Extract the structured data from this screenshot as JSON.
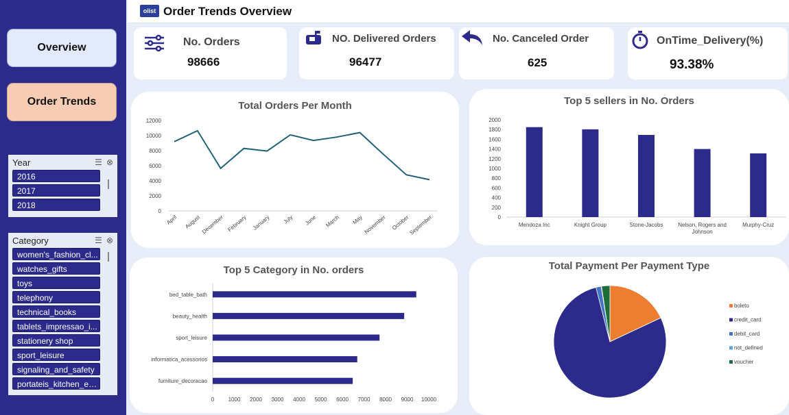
{
  "nav": {
    "overview_label": "Overview",
    "order_trends_label": "Order Trends"
  },
  "header": {
    "logo_text": "olist",
    "title": "Order Trends Overview"
  },
  "slicers": {
    "year": {
      "title": "Year",
      "items": [
        "2016",
        "2017",
        "2018"
      ]
    },
    "category": {
      "title": "Category",
      "items": [
        "women's_fashion_cl...",
        "watches_gifts",
        "toys",
        "telephony",
        "technical_books",
        "tablets_impressao_i...",
        "stationery shop",
        "sport_leisure",
        "signaling_and_safety",
        "portateis_kitchen_e_..."
      ]
    }
  },
  "kpis": {
    "orders": {
      "label": "No. Orders",
      "value": "98666",
      "icon": "sliders-icon"
    },
    "delivered": {
      "label": "NO. Delivered Orders",
      "value": "96477",
      "icon": "mailbox-icon"
    },
    "canceled": {
      "label": "No. Canceled Order",
      "value": "625",
      "icon": "undo-arrow-icon"
    },
    "ontime": {
      "label": "OnTime_Delivery(%)",
      "value": "93.38%",
      "icon": "stopwatch-icon"
    }
  },
  "colors": {
    "navy": "#2c2a8a",
    "line": "#1f6179",
    "boleto": "#ed7d31",
    "credit_card": "#2c2a8a",
    "debit_card": "#4472c4",
    "not_defined": "#5ba3d0",
    "voucher": "#1e6e3a"
  },
  "chart_data": [
    {
      "type": "line",
      "title": "Total Orders Per Month",
      "categories": [
        "April",
        "August",
        "December",
        "February",
        "January",
        "July",
        "June",
        "March",
        "May",
        "November",
        "October",
        "September"
      ],
      "values": [
        9200,
        10650,
        5650,
        8300,
        7950,
        10100,
        9350,
        9800,
        10400,
        7550,
        4800,
        4150
      ],
      "ylim": [
        0,
        12000
      ],
      "yticks": [
        "0",
        "2000",
        "4000",
        "6000",
        "8000",
        "10000",
        "12000"
      ],
      "grid": false
    },
    {
      "type": "bar",
      "title": "Top 5 sellers in No. Orders",
      "categories": [
        "Mendoza Inc",
        "Knight Group",
        "Stone-Jacobs",
        "Nelson, Rogers and Johnson",
        "Murphy-Cruz"
      ],
      "values": [
        1850,
        1805,
        1690,
        1400,
        1310
      ],
      "ylim": [
        0,
        2000
      ],
      "yticks": [
        "0",
        "200",
        "400",
        "600",
        "800",
        "1000",
        "1200",
        "1400",
        "1600",
        "1800",
        "2000"
      ]
    },
    {
      "type": "bar",
      "orientation": "horizontal",
      "title": "Top 5 Category in No. orders",
      "categories": [
        "bed_table_bath",
        "beauty_health",
        "sport_leisure",
        "informatica_acessorios",
        "furniture_decoracao"
      ],
      "values": [
        9420,
        8860,
        7720,
        6690,
        6480
      ],
      "xlim": [
        0,
        10000
      ],
      "xticks": [
        "0",
        "1000",
        "2000",
        "3000",
        "4000",
        "5000",
        "6000",
        "7000",
        "8000",
        "9000",
        "10000"
      ]
    },
    {
      "type": "pie",
      "title": "Total Payment Per Payment Type",
      "labels": [
        "boleto",
        "credit_card",
        "debit_card",
        "not_defined",
        "voucher"
      ],
      "values": [
        18,
        78,
        1.5,
        0.1,
        2.4
      ],
      "legend": "right"
    }
  ]
}
